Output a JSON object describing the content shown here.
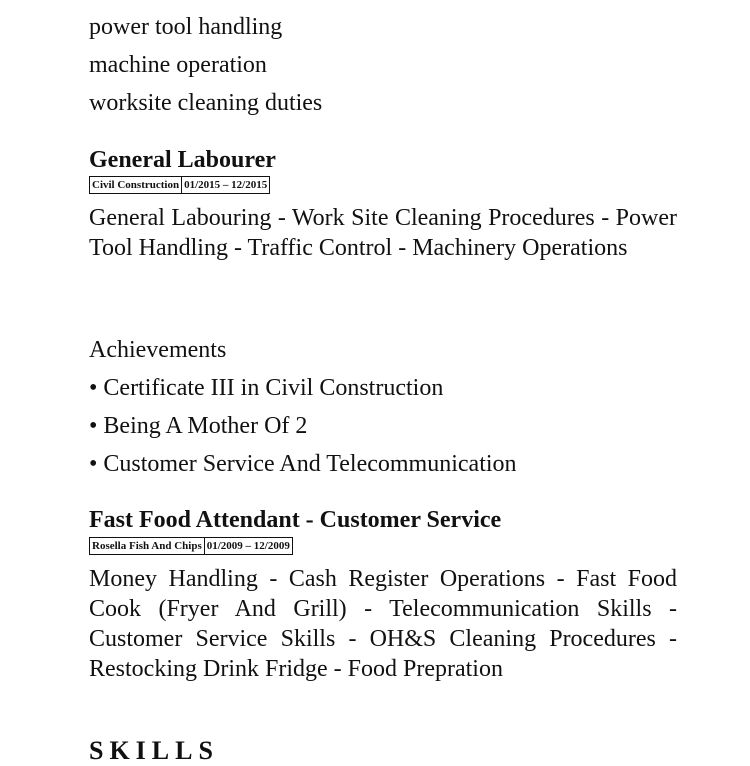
{
  "duties": [
    "power tool handling",
    "machine operation",
    "worksite cleaning duties"
  ],
  "jobs": [
    {
      "title": "General Labourer",
      "company": "Civil Construction",
      "dates": "01/2015 – 12/2015",
      "description": "General Labouring - Work Site Cleaning Procedures - Power Tool Handling - Traffic Control - Machinery Operations"
    },
    {
      "title": "Fast Food Attendant - Customer Service",
      "company": "Rosella Fish And Chips",
      "dates": "01/2009 – 12/2009",
      "description": "Money Handling - Cash Register Operations - Fast Food Cook (Fryer And Grill) - Telecommunication Skills - Customer Service Skills - OH&S Cleaning Procedures - Restocking Drink Fridge - Food Prepration"
    }
  ],
  "achievements": {
    "heading": "Achievements",
    "items": [
      "• Certificate III in Civil Construction",
      "• Being A Mother Of 2",
      "• Customer Service And Telecommunication"
    ]
  },
  "skills_heading": "SKILLS"
}
